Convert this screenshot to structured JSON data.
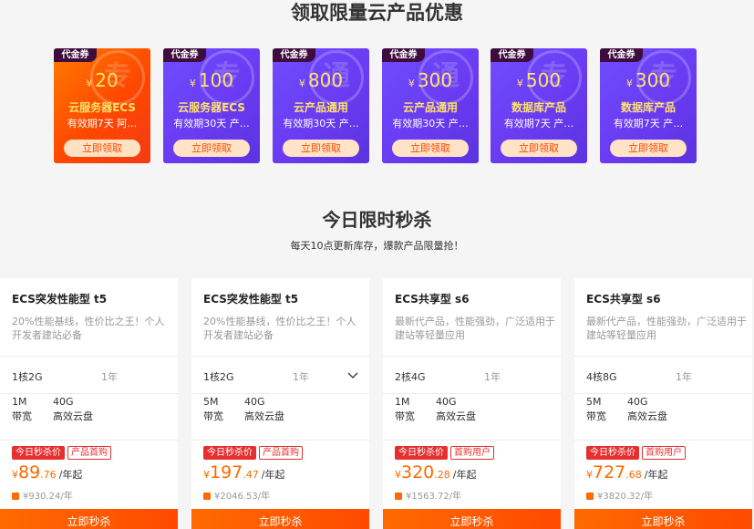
{
  "coupon_section": {
    "title": "领取限量云产品优惠",
    "coupons": [
      {
        "tag": "代金券",
        "currency": "¥",
        "amount": "20",
        "name": "云服务器ECS",
        "sub": "有效期7天 阿…",
        "button": "立即领取",
        "watermark": "专",
        "style": "orange"
      },
      {
        "tag": "代金券",
        "currency": "¥",
        "amount": "100",
        "name": "云服务器ECS",
        "sub": "有效期30天 产…",
        "button": "立即领取",
        "watermark": "专",
        "style": "purple"
      },
      {
        "tag": "代金券",
        "currency": "¥",
        "amount": "800",
        "name": "云产品通用",
        "sub": "有效期30天 产…",
        "button": "立即领取",
        "watermark": "通",
        "style": "purple"
      },
      {
        "tag": "代金券",
        "currency": "¥",
        "amount": "300",
        "name": "云产品通用",
        "sub": "有效期30天 产…",
        "button": "立即领取",
        "watermark": "通",
        "style": "purple"
      },
      {
        "tag": "代金券",
        "currency": "¥",
        "amount": "500",
        "name": "数据库产品",
        "sub": "有效期7天 产…",
        "button": "立即领取",
        "watermark": "专",
        "style": "purple"
      },
      {
        "tag": "代金券",
        "currency": "¥",
        "amount": "300",
        "name": "数据库产品",
        "sub": "有效期7天 产…",
        "button": "立即领取",
        "watermark": "专",
        "style": "purple"
      }
    ],
    "colors": {
      "orange": "#ff5500",
      "purple": "#6a3bf2",
      "amount": "#ffe36a",
      "tag_bg": "#3e0d3e"
    }
  },
  "flash_section": {
    "title": "今日限时秒杀",
    "subtitle": "每天10点更新库存，爆款产品限量抢！",
    "products": [
      {
        "title": "ECS突发性能型 t5",
        "desc": "20%性能基线，性价比之王！个人开发者建站必备",
        "cpu": "1核2G",
        "duration": "1年",
        "has_chevron": false,
        "bandwidth_value": "1M",
        "bandwidth_label": "带宽",
        "disk_value": "40G",
        "disk_label": "高效云盘",
        "badge_hot": "今日秒杀价",
        "badge_tag": "产品首购",
        "currency": "¥",
        "price_int": "89",
        "price_dec": ".76",
        "price_unit": "/年起",
        "original": "¥930.24/年",
        "button": "立即秒杀"
      },
      {
        "title": "ECS突发性能型 t5",
        "desc": "20%性能基线，性价比之王！个人开发者建站必备",
        "cpu": "1核2G",
        "duration": "1年",
        "has_chevron": true,
        "bandwidth_value": "5M",
        "bandwidth_label": "带宽",
        "disk_value": "40G",
        "disk_label": "高效云盘",
        "badge_hot": "今日秒杀价",
        "badge_tag": "产品首购",
        "currency": "¥",
        "price_int": "197",
        "price_dec": ".47",
        "price_unit": "/年起",
        "original": "¥2046.53/年",
        "button": "立即秒杀"
      },
      {
        "title": "ECS共享型 s6",
        "desc": "最新代产品，性能强劲，广泛适用于建站等轻量应用",
        "cpu": "2核4G",
        "duration": "1年",
        "has_chevron": false,
        "bandwidth_value": "1M",
        "bandwidth_label": "带宽",
        "disk_value": "40G",
        "disk_label": "高效云盘",
        "badge_hot": "今日秒杀价",
        "badge_tag": "首购用户",
        "currency": "¥",
        "price_int": "320",
        "price_dec": ".28",
        "price_unit": "/年起",
        "original": "¥1563.72/年",
        "button": "立即秒杀"
      },
      {
        "title": "ECS共享型 s6",
        "desc": "最新代产品，性能强劲，广泛适用于建站等轻量应用",
        "cpu": "4核8G",
        "duration": "1年",
        "has_chevron": false,
        "bandwidth_value": "5M",
        "bandwidth_label": "带宽",
        "disk_value": "40G",
        "disk_label": "高效云盘",
        "badge_hot": "今日秒杀价",
        "badge_tag": "首购用户",
        "currency": "¥",
        "price_int": "727",
        "price_dec": ".68",
        "price_unit": "/年起",
        "original": "¥3820.32/年",
        "button": "立即秒杀"
      }
    ],
    "colors": {
      "price": "#ff6a00",
      "hot_badge": "#e62f2f",
      "buy_button": "#ff5a00"
    }
  }
}
